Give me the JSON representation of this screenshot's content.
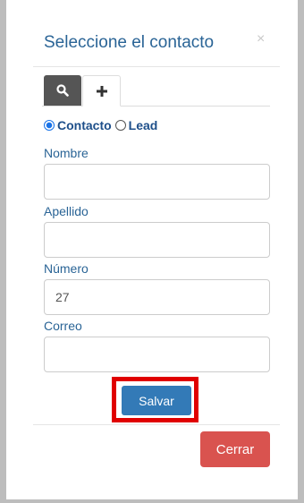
{
  "modal": {
    "title": "Seleccione el contacto",
    "close_glyph": "×"
  },
  "tabs": [
    {
      "icon": "search-icon",
      "active": true
    },
    {
      "icon": "plus-icon",
      "active": false
    }
  ],
  "radio": {
    "options": [
      {
        "label": "Contacto",
        "checked": true
      },
      {
        "label": "Lead",
        "checked": false
      }
    ]
  },
  "form": {
    "fields": [
      {
        "label": "Nombre",
        "value": ""
      },
      {
        "label": "Apellido",
        "value": ""
      },
      {
        "label": "Número",
        "value": "27"
      },
      {
        "label": "Correo",
        "value": ""
      }
    ],
    "save_label": "Salvar"
  },
  "footer": {
    "close_label": "Cerrar"
  },
  "colors": {
    "primary": "#337ab7",
    "danger": "#d9534f",
    "highlight": "#e00000",
    "title": "#2a6496"
  }
}
